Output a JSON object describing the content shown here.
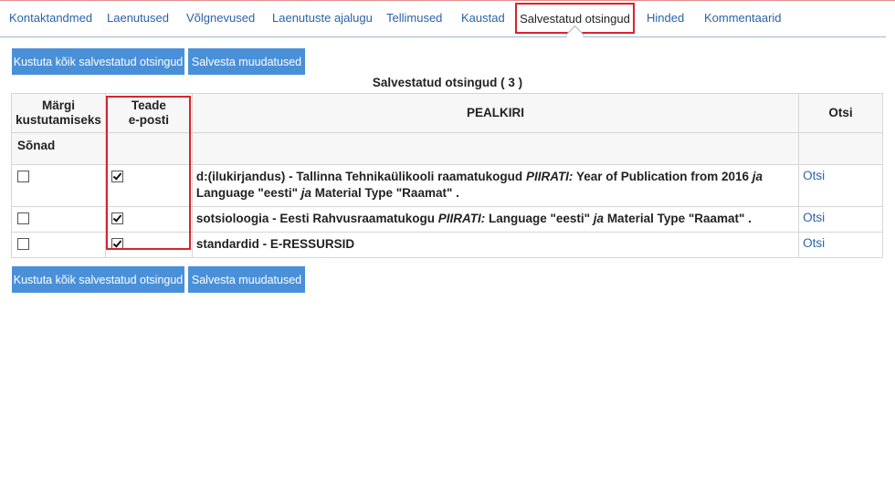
{
  "tabs": [
    {
      "label": "Kontaktandmed"
    },
    {
      "label": "Laenutused"
    },
    {
      "label": "Võlgnevused"
    },
    {
      "label": "Laenutuste ajalugu"
    },
    {
      "label": "Tellimused"
    },
    {
      "label": "Kaustad"
    },
    {
      "label": "Salvestatud otsingud",
      "active": true
    },
    {
      "label": "Hinded"
    },
    {
      "label": "Kommentaarid"
    }
  ],
  "buttons": {
    "delete_all": "Kustuta kõik salvestatud otsingud",
    "save_changes": "Salvesta muudatused"
  },
  "title": "Salvestatud otsingud ( 3 )",
  "table": {
    "headers": {
      "mark_delete_1": "Märgi",
      "mark_delete_2": "kustutamiseks",
      "notify_1": "Teade",
      "notify_2": "e-posti",
      "title": "PEALKIRI",
      "search": "Otsi"
    },
    "section_label": "Sõnad",
    "rows": [
      {
        "delete_checked": false,
        "notify_checked": true,
        "parts": [
          {
            "t": "d:(ilukirjandus) - Tallinna Tehnikaülikooli raamatukogud ",
            "s": "b"
          },
          {
            "t": "PIIRATI:",
            "s": "bi"
          },
          {
            "t": " Year of Publication from 2016 ",
            "s": "b"
          },
          {
            "t": "ja",
            "s": "bi"
          },
          {
            "t": " Language \"eesti\" ",
            "s": "b"
          },
          {
            "t": "ja",
            "s": "bi"
          },
          {
            "t": " Material Type \"Raamat\" .",
            "s": "b"
          }
        ],
        "link": "Otsi"
      },
      {
        "delete_checked": false,
        "notify_checked": true,
        "parts": [
          {
            "t": "sotsioloogia - Eesti Rahvusraamatukogu ",
            "s": "b"
          },
          {
            "t": "PIIRATI:",
            "s": "bi"
          },
          {
            "t": " Language \"eesti\" ",
            "s": "b"
          },
          {
            "t": "ja",
            "s": "bi"
          },
          {
            "t": " Material Type \"Raamat\" .",
            "s": "b"
          }
        ],
        "link": "Otsi"
      },
      {
        "delete_checked": false,
        "notify_checked": true,
        "parts": [
          {
            "t": "standardid - E-RESSURSID",
            "s": "b"
          }
        ],
        "link": "Otsi"
      }
    ]
  },
  "colors": {
    "link": "#2a62a8",
    "button": "#4a90d9",
    "highlight": "#d9232e"
  }
}
